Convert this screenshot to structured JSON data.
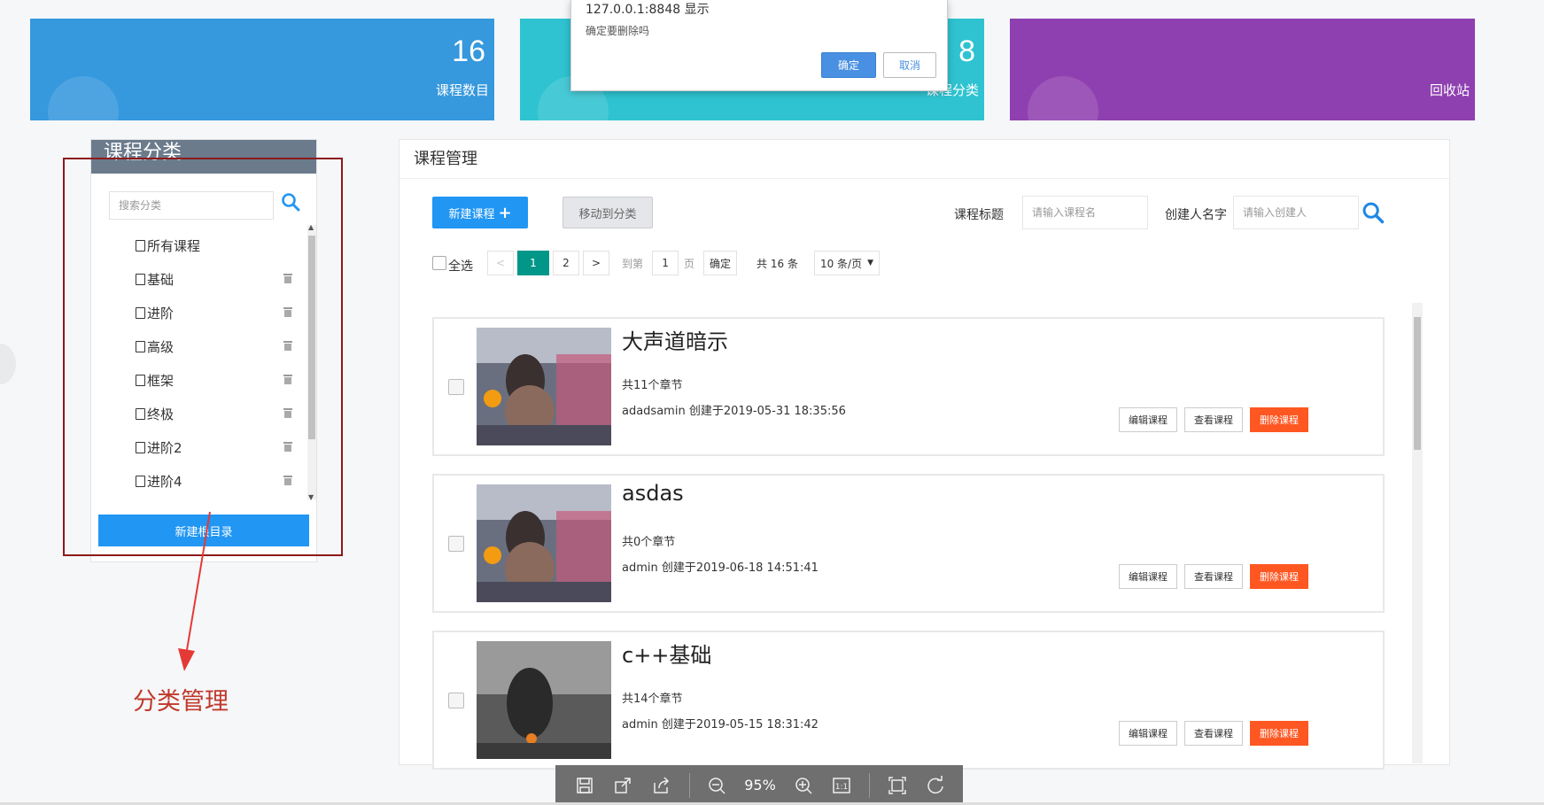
{
  "stats": {
    "courses": {
      "count": "16",
      "label": "课程数目"
    },
    "categories": {
      "count": "8",
      "label": "课程分类"
    },
    "recycle": {
      "label": "回收站"
    }
  },
  "dialog": {
    "title": "127.0.0.1:8848 显示",
    "message": "确定要删除吗",
    "ok": "确定",
    "cancel": "取消"
  },
  "category_panel": {
    "title": "课程分类",
    "search_placeholder": "搜索分类",
    "items": [
      {
        "label": "所有课程",
        "deletable": false
      },
      {
        "label": "基础",
        "deletable": true
      },
      {
        "label": "进阶",
        "deletable": true
      },
      {
        "label": "高级",
        "deletable": true
      },
      {
        "label": "框架",
        "deletable": true
      },
      {
        "label": "终极",
        "deletable": true
      },
      {
        "label": "进阶2",
        "deletable": true
      },
      {
        "label": "进阶4",
        "deletable": true
      }
    ],
    "new_button": "新建根目录"
  },
  "annotation": {
    "label": "分类管理"
  },
  "main": {
    "title": "课程管理",
    "new_button": "新建课程",
    "move_button": "移动到分类",
    "title_label": "课程标题",
    "title_placeholder": "请输入课程名",
    "creator_label": "创建人名字",
    "creator_placeholder": "请输入创建人",
    "select_all": "全选",
    "pager": {
      "prev": "<",
      "pages": [
        "1",
        "2"
      ],
      "next": ">",
      "goto_label": "到第",
      "goto_value": "1",
      "page_unit": "页",
      "confirm": "确定",
      "total": "共 16 条",
      "page_size": "10 条/页"
    },
    "courses": [
      {
        "name": "大声道暗示",
        "chapters": "共11个章节",
        "meta": "adadsamin 创建于2019-05-31 18:35:56"
      },
      {
        "name": "asdas",
        "chapters": "共0个章节",
        "meta": "admin 创建于2019-06-18 14:51:41"
      },
      {
        "name": "c++基础",
        "chapters": "共14个章节",
        "meta": "admin 创建于2019-05-15 18:31:42"
      }
    ],
    "btn_edit": "编辑课程",
    "btn_view": "查看课程",
    "btn_delete": "删除课程"
  },
  "viewer": {
    "zoom": "95%"
  }
}
